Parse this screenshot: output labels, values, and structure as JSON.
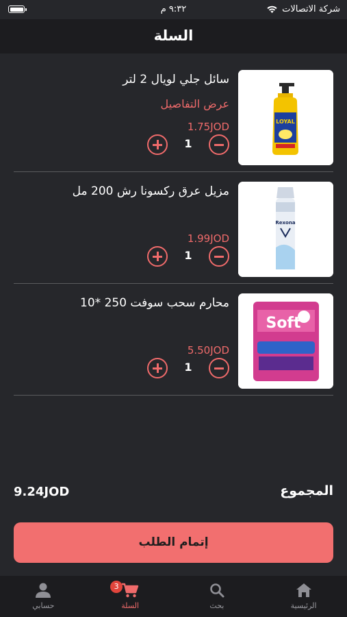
{
  "status_bar": {
    "carrier": "شركة الاتصالات",
    "time": "٩:٣٢ م"
  },
  "header": {
    "title": "السلة"
  },
  "cart": {
    "items": [
      {
        "name": "سائل جلي لويال 2 لتر",
        "details_link": "عرض التفاصيل",
        "price": "1.75JOD",
        "quantity": "1"
      },
      {
        "name": "مزيل عرق ركسونا رش 200 مل",
        "price": "1.99JOD",
        "quantity": "1"
      },
      {
        "name": "محارم سحب سوفت 250 *10",
        "price": "5.50JOD",
        "quantity": "1"
      }
    ]
  },
  "summary": {
    "total_label": "المجموع",
    "total_value": "9.24JOD"
  },
  "checkout": {
    "label": "إتمام الطلب"
  },
  "tab_bar": {
    "tabs": [
      {
        "label": "الرئيسية",
        "icon": "home-icon"
      },
      {
        "label": "بحث",
        "icon": "search-icon"
      },
      {
        "label": "السلة",
        "icon": "cart-icon",
        "badge": "3",
        "active": true
      },
      {
        "label": "حسابي",
        "icon": "person-icon"
      }
    ]
  },
  "colors": {
    "accent": "#f26f6f",
    "background": "#26272b",
    "bar": "#1c1c1f"
  }
}
